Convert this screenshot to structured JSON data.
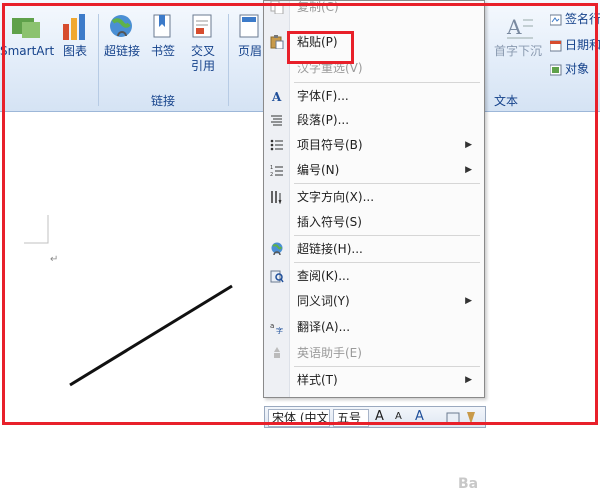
{
  "ribbon": {
    "buttons": {
      "smartart": "SmartArt",
      "chart": "图表",
      "hyperlink": "超链接",
      "bookmark": "书签",
      "cross_ref": "交叉\n引用",
      "header": "页眉",
      "drop_cap": "首字下沉",
      "signature": "签名行",
      "datetime": "日期和",
      "object": "对象"
    },
    "groups": {
      "links": "链接",
      "text": "文本"
    }
  },
  "context_menu": {
    "items": [
      {
        "label": "复制(C)",
        "disabled": true,
        "icon": "copy-icon"
      },
      {
        "label": "粘贴(P)",
        "disabled": false,
        "icon": "paste-icon"
      },
      {
        "label": "汉字重选(V)",
        "disabled": true,
        "icon": ""
      },
      {
        "label": "字体(F)...",
        "disabled": false,
        "icon": "font-icon"
      },
      {
        "label": "段落(P)...",
        "disabled": false,
        "icon": "paragraph-icon"
      },
      {
        "label": "项目符号(B)",
        "disabled": false,
        "icon": "bullets-icon",
        "submenu": true
      },
      {
        "label": "编号(N)",
        "disabled": false,
        "icon": "numbering-icon",
        "submenu": true
      },
      {
        "label": "文字方向(X)...",
        "disabled": false,
        "icon": "text-direction-icon"
      },
      {
        "label": "插入符号(S)",
        "disabled": false,
        "icon": ""
      },
      {
        "label": "超链接(H)...",
        "disabled": false,
        "icon": "hyperlink-icon"
      },
      {
        "label": "查阅(K)...",
        "disabled": false,
        "icon": "lookup-icon"
      },
      {
        "label": "同义词(Y)",
        "disabled": false,
        "icon": "",
        "submenu": true
      },
      {
        "label": "翻译(A)...",
        "disabled": false,
        "icon": "translate-icon"
      },
      {
        "label": "英语助手(E)",
        "disabled": true,
        "icon": "english-assistant-icon"
      },
      {
        "label": "样式(T)",
        "disabled": false,
        "icon": "",
        "submenu": true
      }
    ]
  },
  "mini_toolbar": {
    "font": "宋体 (中文",
    "size": "五号",
    "grow": "A",
    "shrink": "A",
    "font_color": "A"
  },
  "watermark": "Ba"
}
